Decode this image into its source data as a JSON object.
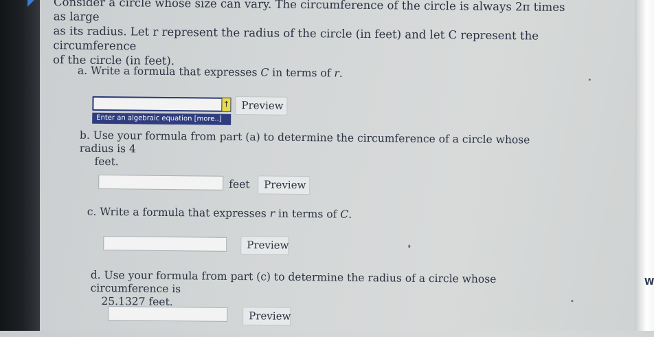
{
  "problem": {
    "line1": "Consider a circle whose size can vary. The circumference of the circle is always 2π times as large",
    "line2": "as its radius. Let r represent the radius of the circle (in feet) and let C represent the circumference",
    "line3": "of the circle (in feet)."
  },
  "parts": {
    "a": {
      "prefix": "a. Write a formula that expresses ",
      "var1": "C",
      "mid": " in terms of ",
      "var2": "r",
      "suffix": ".",
      "input_value": "",
      "hint": "Enter an algebraic equation [more..]",
      "preview_label": "Preview"
    },
    "b": {
      "line1": "b. Use your formula from part (a) to determine the circumference of a circle whose radius is 4",
      "line2": "feet.",
      "input_value": "",
      "unit": "feet",
      "preview_label": "Preview"
    },
    "c": {
      "prefix": "c. Write a formula that expresses ",
      "var1": "r",
      "mid": " in terms of ",
      "var2": "C",
      "suffix": ".",
      "input_value": "",
      "preview_label": "Preview"
    },
    "d": {
      "line1": "d. Use your formula from part (c) to determine the radius of a circle whose circumference is",
      "line2": "25.1327 feet.",
      "input_value": "",
      "preview_label": "Preview"
    }
  },
  "edge_text": "W",
  "icons": {
    "input_arrow": "↑"
  },
  "colors": {
    "hint_background": "#2f3d7f",
    "arrow_highlight": "#e9dc4b",
    "focus_border": "#2c3b78"
  }
}
